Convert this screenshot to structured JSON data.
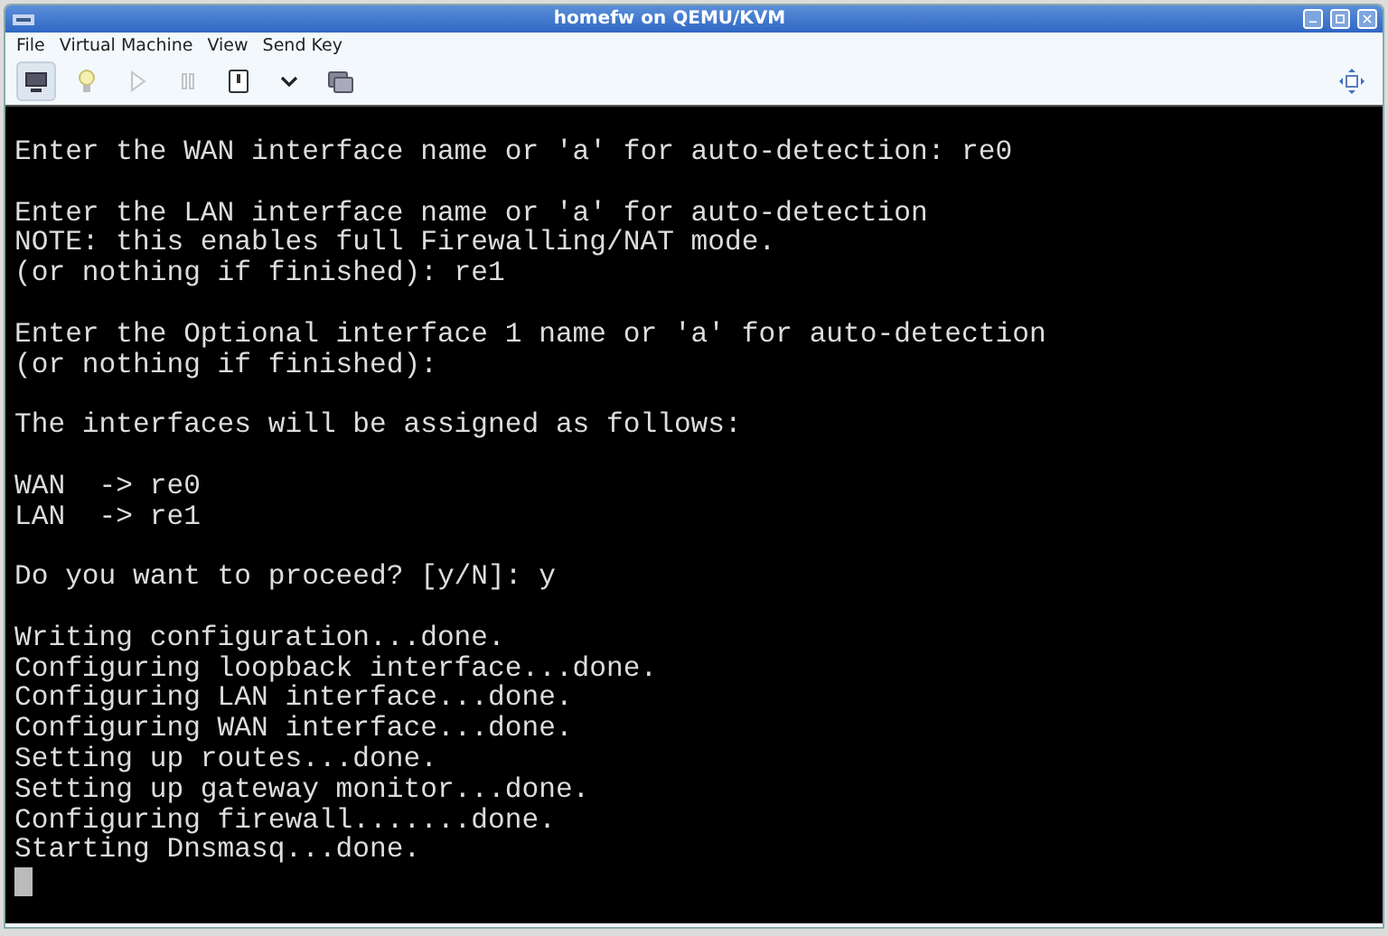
{
  "window": {
    "title": "homefw on QEMU/KVM"
  },
  "menu": [
    "File",
    "Virtual Machine",
    "View",
    "Send Key"
  ],
  "toolbar": {
    "buttons": [
      {
        "kind": "monitor",
        "selected": true,
        "disabled": false
      },
      {
        "kind": "bulb",
        "selected": false,
        "disabled": false
      },
      {
        "kind": "play",
        "selected": false,
        "disabled": true
      },
      {
        "kind": "pause",
        "selected": false,
        "disabled": true
      },
      {
        "kind": "power",
        "selected": false,
        "disabled": false
      },
      {
        "kind": "caret",
        "selected": false,
        "disabled": false
      },
      {
        "kind": "screens",
        "selected": false,
        "disabled": false
      }
    ]
  },
  "console": {
    "blocks": [
      [
        "Enter the WAN interface name or 'a' for auto-detection: re0"
      ],
      [
        "Enter the LAN interface name or 'a' for auto-detection",
        "NOTE: this enables full Firewalling/NAT mode.",
        "(or nothing if finished): re1"
      ],
      [
        "Enter the Optional interface 1 name or 'a' for auto-detection",
        "(or nothing if finished):"
      ],
      [
        "The interfaces will be assigned as follows:"
      ],
      [
        "WAN  -> re0",
        "LAN  -> re1"
      ],
      [
        "Do you want to proceed? [y/N]: y"
      ],
      [
        "Writing configuration...done.",
        "Configuring loopback interface...done.",
        "Configuring LAN interface...done.",
        "Configuring WAN interface...done.",
        "Setting up routes...done.",
        "Setting up gateway monitor...done.",
        "Configuring firewall.......done.",
        "Starting Dnsmasq...done."
      ]
    ],
    "cursor": true
  }
}
